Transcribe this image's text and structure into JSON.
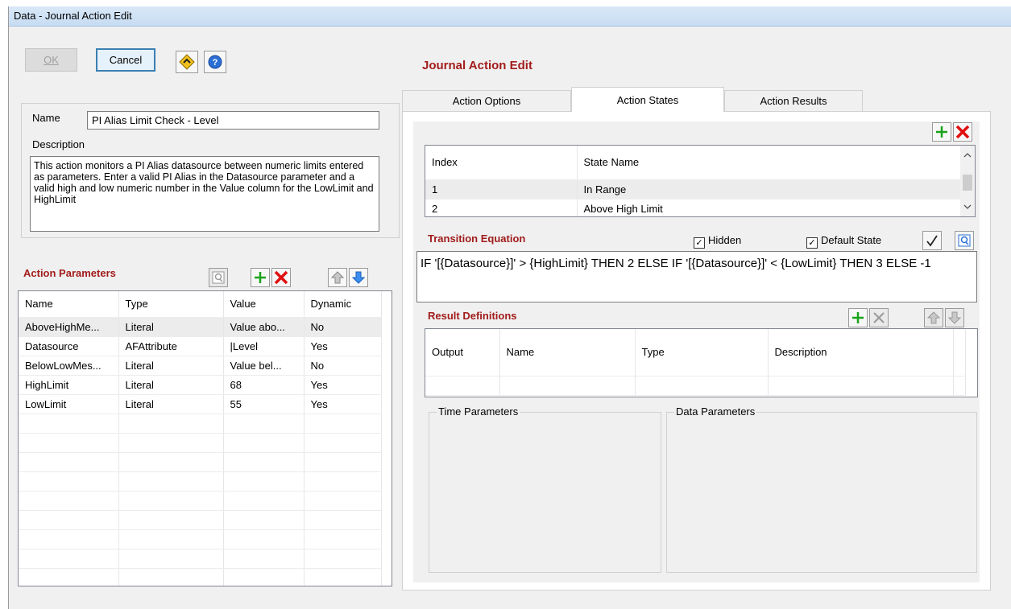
{
  "window": {
    "title": "Data -  Journal Action Edit"
  },
  "toolbar": {
    "ok_label": "OK",
    "cancel_label": "Cancel"
  },
  "form": {
    "name_label": "Name",
    "name_value": "PI Alias Limit Check - Level",
    "description_label": "Description",
    "description_value": "This action monitors a PI Alias datasource between numeric limits entered as parameters.  Enter a valid PI Alias in the Datasource parameter and a valid high and low numeric number in the Value column for the LowLimit and HighLimit"
  },
  "action_parameters": {
    "title": "Action Parameters",
    "columns": [
      "Name",
      "Type",
      "Value",
      "Dynamic"
    ],
    "rows": [
      [
        "AboveHighMe...",
        "Literal",
        "Value abo...",
        "No"
      ],
      [
        "Datasource",
        "AFAttribute",
        "|Level",
        "Yes"
      ],
      [
        "BelowLowMes...",
        "Literal",
        "Value bel...",
        "No"
      ],
      [
        "HighLimit",
        "Literal",
        "68",
        "Yes"
      ],
      [
        "LowLimit",
        "Literal",
        "55",
        "Yes"
      ]
    ]
  },
  "editor": {
    "title": "Journal Action Edit",
    "tabs": [
      "Action Options",
      "Action States",
      "Action Results"
    ],
    "states": {
      "columns": [
        "Index",
        "State Name"
      ],
      "rows": [
        [
          "1",
          "In Range"
        ],
        [
          "2",
          "Above High Limit"
        ]
      ]
    },
    "transition": {
      "title": "Transition Equation",
      "hidden_label": "Hidden",
      "default_state_label": "Default State",
      "equation": "IF '[{Datasource}]' > {HighLimit} THEN 2 ELSE IF '[{Datasource}]' < {LowLimit} THEN 3 ELSE -1"
    },
    "results": {
      "title": "Result Definitions",
      "columns": [
        "Output",
        "Name",
        "Type",
        "Description"
      ]
    },
    "time_parameters_label": "Time Parameters",
    "data_parameters_label": "Data Parameters"
  },
  "colors": {
    "accent_red": "#a21c1c",
    "add_green": "#1aa31a",
    "delete_red": "#e01010"
  }
}
